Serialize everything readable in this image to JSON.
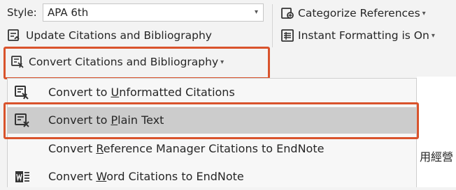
{
  "ribbon": {
    "style_label": "Style:",
    "style_value": "APA 6th",
    "update_label": "Update Citations and Bibliography",
    "convert_label": "Convert Citations and Bibliography",
    "categorize_label": "Categorize References",
    "instant_label": "Instant Formatting is On"
  },
  "menu": {
    "items": [
      {
        "pre": "Convert to ",
        "mnemonic": "U",
        "post": "nformatted Citations",
        "icon": "unformatted-citations-icon",
        "hover": false
      },
      {
        "pre": "Convert to ",
        "mnemonic": "P",
        "post": "lain Text",
        "icon": "plain-text-icon",
        "hover": true
      },
      {
        "pre": "Convert ",
        "mnemonic": "R",
        "post": "eference Manager Citations to EndNote",
        "icon": "",
        "hover": false
      },
      {
        "pre": "Convert ",
        "mnemonic": "W",
        "post": "ord Citations to EndNote",
        "icon": "word-endnote-icon",
        "hover": false
      }
    ]
  },
  "document": {
    "visible_text": "用經營"
  },
  "colors": {
    "highlight": "#d9532c",
    "hover": "#cccccc",
    "ribbon_bg": "#f3f3f3",
    "menu_bg": "#f7f7f7"
  }
}
